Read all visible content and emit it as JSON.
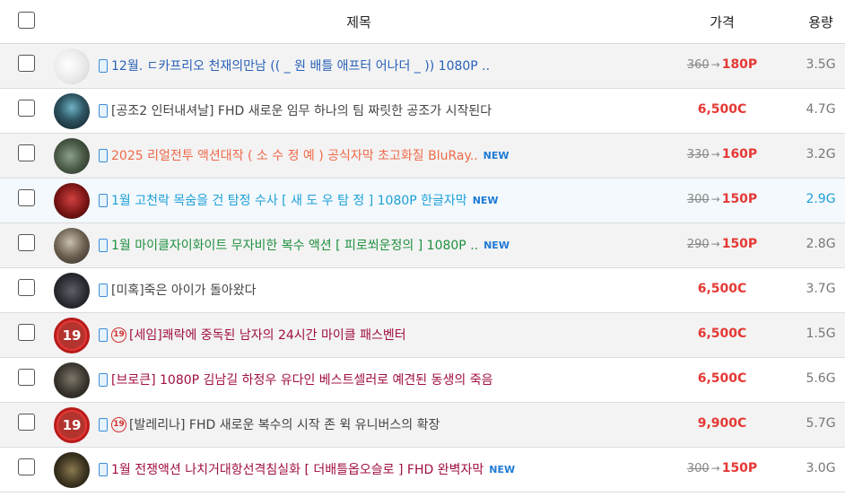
{
  "header": {
    "title": "제목",
    "price": "가격",
    "size": "용량"
  },
  "rows": [
    {
      "title": "12월. ㄷ카프리오 천재의만남 (( _ 원 배틀 애프터 어나더 _ )) 1080P ..",
      "new": "",
      "old_price": "360",
      "arrow": "→",
      "new_price": "180P",
      "flat_price": "",
      "size": "3.5G",
      "color": "#2a62b8",
      "adult": ""
    },
    {
      "title": "[공조2 인터내셔날] FHD 새로운 임무 하나의 팀 짜릿한 공조가 시작된다",
      "new": "",
      "old_price": "",
      "arrow": "",
      "new_price": "",
      "flat_price": "6,500C",
      "size": "4.7G",
      "color": "#444444",
      "adult": ""
    },
    {
      "title": "2025 리얼전투 액션대작 ( 소 수 정 예 ) 공식자막 초고화질 BluRay..",
      "new": "NEW",
      "old_price": "330",
      "arrow": "→",
      "new_price": "160P",
      "flat_price": "",
      "size": "3.2G",
      "color": "#ef6a4a",
      "adult": ""
    },
    {
      "title": "1월 고천락 목숨을 건 탐정 수사 [ 새 도 우 탐 정 ] 1080P 한글자막",
      "new": "NEW",
      "old_price": "300",
      "arrow": "→",
      "new_price": "150P",
      "flat_price": "",
      "size": "2.9G",
      "color": "#1e9fd8",
      "adult": ""
    },
    {
      "title": "1월 마이클자이화이트 무자비한 복수 액션 [ 피로쐬운정의 ] 1080P ..",
      "new": "NEW",
      "old_price": "290",
      "arrow": "→",
      "new_price": "150P",
      "flat_price": "",
      "size": "2.8G",
      "color": "#1f8f3f",
      "adult": ""
    },
    {
      "title": "[미혹]죽은 아이가 돌아왔다",
      "new": "",
      "old_price": "",
      "arrow": "",
      "new_price": "",
      "flat_price": "6,500C",
      "size": "3.7G",
      "color": "#444444",
      "adult": ""
    },
    {
      "title": "[세임]쾌락에 중독된 남자의 24시간 마이클 패스벤터",
      "new": "",
      "old_price": "",
      "arrow": "",
      "new_price": "",
      "flat_price": "6,500C",
      "size": "1.5G",
      "color": "#a01040",
      "adult": "19"
    },
    {
      "title": "[브로큰] 1080P 김남길 하정우 유다인 베스트셀러로 예견된 동생의 죽음",
      "new": "",
      "old_price": "",
      "arrow": "",
      "new_price": "",
      "flat_price": "6,500C",
      "size": "5.6G",
      "color": "#a01040",
      "adult": ""
    },
    {
      "title": "[발레리나] FHD 새로운 복수의 시작 존 윅 유니버스의 확장",
      "new": "",
      "old_price": "",
      "arrow": "",
      "new_price": "",
      "flat_price": "9,900C",
      "size": "5.7G",
      "color": "#444444",
      "adult": "19"
    },
    {
      "title": "1월 전쟁액션 나치거대항선격침실화 [ 더배틀옵오슬로 ] FHD 완벽자막",
      "new": "NEW",
      "old_price": "300",
      "arrow": "→",
      "new_price": "150P",
      "flat_price": "",
      "size": "3.0G",
      "color": "#a01040",
      "adult": ""
    }
  ],
  "thumb_badge": "19"
}
